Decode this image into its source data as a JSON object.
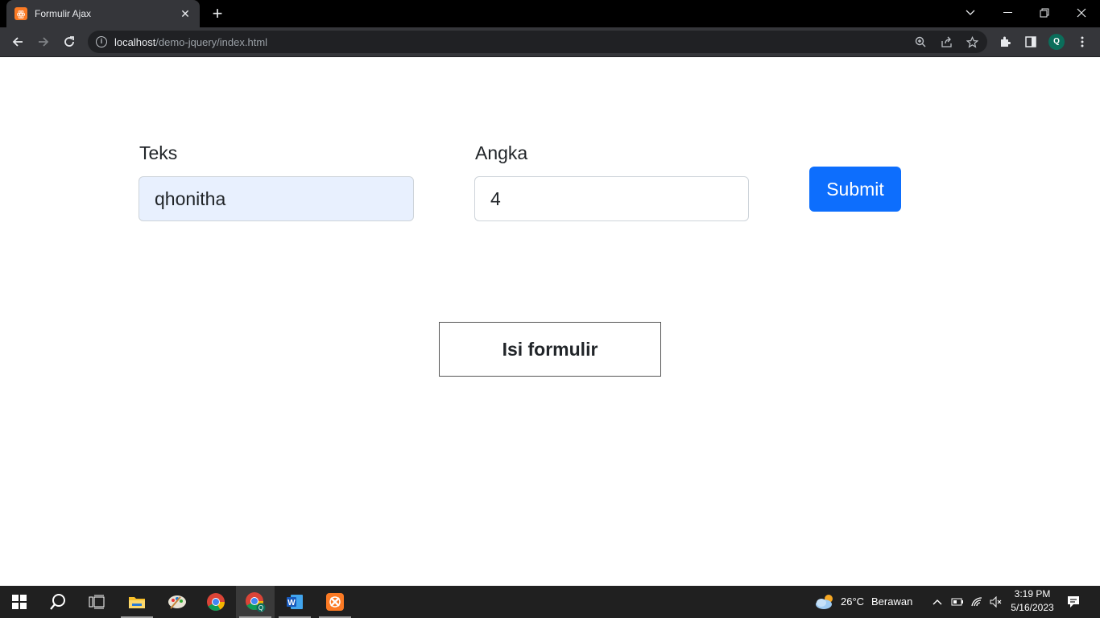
{
  "browser": {
    "tab_title": "Formulir Ajax",
    "tab_favicon": "xampp-icon",
    "url_host": "localhost",
    "url_path": "/demo-jquery/index.html",
    "profile_initial": "Q"
  },
  "form": {
    "text_label": "Teks",
    "text_value": "qhonitha",
    "number_label": "Angka",
    "number_value": "4",
    "submit_label": "Submit"
  },
  "result": {
    "message": "Isi formulir"
  },
  "taskbar": {
    "weather_temp": "26°C",
    "weather_desc": "Berawan",
    "time": "3:19 PM",
    "date": "5/16/2023"
  },
  "colors": {
    "primary_button": "#0d6efd",
    "autofill_bg": "#e8f0fe",
    "chrome_toolbar": "#35363a"
  }
}
